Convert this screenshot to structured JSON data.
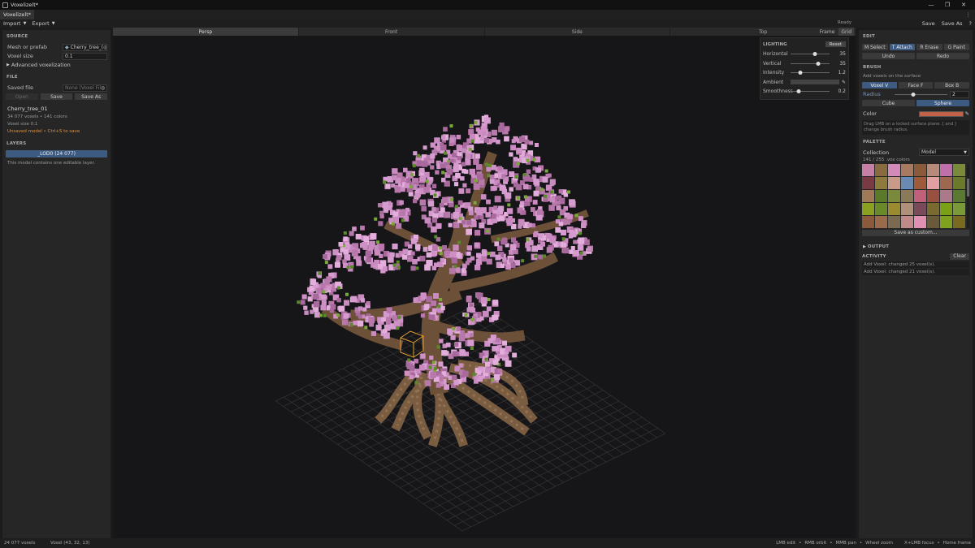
{
  "window": {
    "title": "Voxelizelt*",
    "tab": "Voxelizelt*"
  },
  "menu": {
    "import": "Import",
    "export": "Export",
    "status": "Ready",
    "save": "Save",
    "save_as": "Save As",
    "help": "?"
  },
  "left": {
    "source_title": "SOURCE",
    "mesh_label": "Mesh or prefab",
    "mesh_value": "Cherry_tree_(",
    "voxel_size_label": "Voxel size",
    "voxel_size_value": "0.1",
    "advanced": "Advanced voxelization",
    "file_title": "FILE",
    "saved_file_label": "Saved file",
    "saved_file_value": "None (Voxel Fil",
    "open": "Open",
    "save": "Save",
    "save_as": "Save As",
    "model_name": "Cherry_tree_01",
    "model_stats": "34 077 voxels  •  141 colors",
    "model_voxel_size": "Voxel size  0.1",
    "unsaved": "Unsaved model  •  Ctrl+S to save",
    "layers_title": "LAYERS",
    "layer_label": "_LOD0  (24 077)",
    "layer_note": "This model contains one editable layer."
  },
  "viewport": {
    "tabs": [
      "Persp",
      "Front",
      "Side",
      "Top"
    ],
    "frame": "Frame",
    "grid": "Grid"
  },
  "lighting": {
    "title": "LIGHTING",
    "reset": "Reset",
    "rows": [
      {
        "name": "Horizontal",
        "value": "35",
        "level": 0.62
      },
      {
        "name": "Vertical",
        "value": "35",
        "level": 0.7
      },
      {
        "name": "Intensity",
        "value": "1.2",
        "level": 0.25
      }
    ],
    "ambient": "Ambient",
    "smoothness": {
      "name": "Smoothness",
      "value": "0.2",
      "level": 0.2
    }
  },
  "right": {
    "edit_title": "EDIT",
    "select": "M Select",
    "attach": "T Attach",
    "erase": "R Erase",
    "paint": "G Paint",
    "undo": "Undo",
    "redo": "Redo",
    "brush_title": "BRUSH",
    "brush_hint": "Add voxels on the surface",
    "voxel": "Voxel  V",
    "face": "Face  F",
    "box": "Box  B",
    "radius_label": "Radius",
    "radius_value": "2",
    "radius_level": 0.35,
    "cube": "Cube",
    "sphere": "Sphere",
    "color_label": "Color",
    "color_value": "#c2624a",
    "help_text": "Drag LMB on a locked surface plane. [ and ] change brush radius.",
    "palette_title": "PALETTE",
    "collection_label": "Collection",
    "collection_value": "Model",
    "palette_count": "141 / 255  .vox colors",
    "save_custom": "Save as custom...",
    "output_title": "OUTPUT",
    "activity_title": "ACTIVITY",
    "clear": "Clear",
    "activity": [
      "Add Voxel: changed 25 voxel(s).",
      "Add Voxel: changed 21 voxel(s)."
    ]
  },
  "palette_colors": [
    "#c87fa6",
    "#8a6a40",
    "#d28ab8",
    "#a87a60",
    "#8a5a3a",
    "#b88a7a",
    "#c070a8",
    "#7a8a3a",
    "#7a3a44",
    "#8e7a3a",
    "#c79a8a",
    "#6a8ab0",
    "#9e5a3a",
    "#e3a0a0",
    "#9e6850",
    "#6a7a2a",
    "#a07a58",
    "#5a7a2a",
    "#7a8a3a",
    "#8a7a5a",
    "#c0607a",
    "#9a5040",
    "#aa7a8a",
    "#5a7a34",
    "#8aa020",
    "#6a8a2a",
    "#9a8a30",
    "#b0907a",
    "#7a4a5a",
    "#7a6a30",
    "#7aa018",
    "#7a9a38",
    "#8a5a3a",
    "#9a6a4a",
    "#7a6a50",
    "#c08a8a",
    "#e090b0",
    "#6a5a3a",
    "#80a020",
    "#7a6a20"
  ],
  "status": {
    "voxels": "24 077 voxels",
    "coords": "Voxel (43, 32, 13)",
    "hints": [
      "LMB edit",
      "RMB orbit",
      "MMB pan",
      "Wheel zoom",
      "X+LMB focus",
      "Home frame"
    ]
  }
}
